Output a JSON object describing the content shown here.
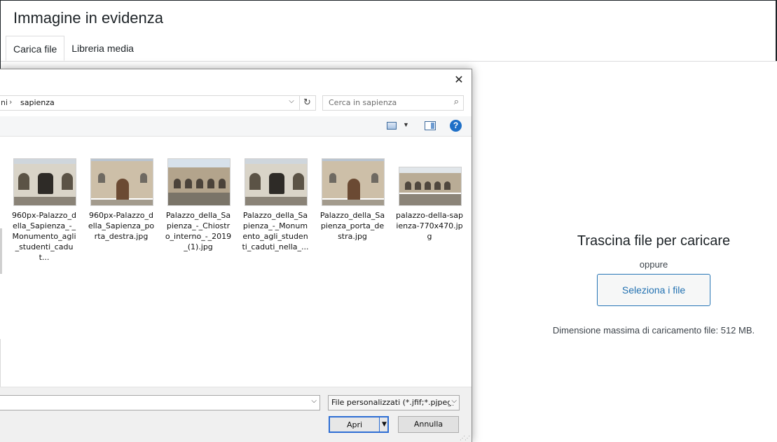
{
  "wp_modal": {
    "title": "Immagine in evidenza",
    "tabs": [
      {
        "label": "Carica file",
        "active": true
      },
      {
        "label": "Libreria media",
        "active": false
      }
    ],
    "uploader": {
      "title": "Trascina file per caricare",
      "or_text": "oppure",
      "select_button": "Seleziona i file",
      "max_size": "Dimensione massima di caricamento file: 512 MB."
    }
  },
  "file_dialog": {
    "close_icon": "close-icon",
    "address": {
      "previous_segment": "ni",
      "separator": "›",
      "current_folder": "sapienza"
    },
    "search_placeholder": "Cerca in sapienza",
    "toolbar": {
      "view_icon": "view-mode-icon",
      "pane_icon": "preview-pane-icon",
      "help_icon": "?"
    },
    "files": [
      {
        "name": "960px-Palazzo_della_Sapienza_-_Monumento_agli_studenti_cadut...",
        "type": "monument"
      },
      {
        "name": "960px-Palazzo_della_Sapienza_porta_destra.jpg",
        "type": "facade"
      },
      {
        "name": "Palazzo_della_Sapienza_-_Chiostro_interno_-_2019_(1).jpg",
        "type": "courtyard"
      },
      {
        "name": "Palazzo_della_Sapienza_-_Monumento_agli_studenti_caduti_nella_...",
        "type": "monument"
      },
      {
        "name": "Palazzo_della_Sapienza_porta_destra.jpg",
        "type": "facade"
      },
      {
        "name": "palazzo-della-sapienza-770x470.jpg",
        "type": "courtyard"
      }
    ],
    "filename_value": "",
    "filter_label": "File personalizzati (*.jfif;*.pjpeg;",
    "open_button": "Apri",
    "cancel_button": "Annulla"
  }
}
